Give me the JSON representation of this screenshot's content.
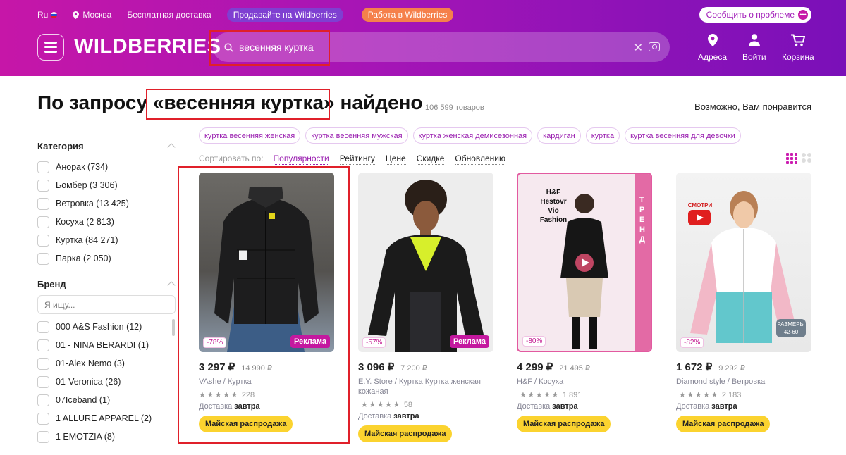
{
  "topbar": {
    "lang": "Ru",
    "city": "Москва",
    "delivery": "Бесплатная доставка",
    "sell": "Продавайте на Wildberries",
    "work": "Работа в Wildberries",
    "report": "Сообщить о проблеме"
  },
  "header": {
    "logo": "WILDBERRIES",
    "search_value": "весенняя куртка",
    "addresses": "Адреса",
    "login": "Войти",
    "cart": "Корзина"
  },
  "results": {
    "title_prefix": "По запросу ",
    "query": "«весенняя куртка»",
    "title_suffix": " найдено",
    "count": "106 599 товаров",
    "maybe": "Возможно, Вам понравится"
  },
  "tags": [
    "куртка весенняя женская",
    "куртка весенняя мужская",
    "куртка женская демисезонная",
    "кардиган",
    "куртка",
    "куртка весенняя для девочки"
  ],
  "sort": {
    "label": "Сортировать по:",
    "options": [
      "Популярности",
      "Рейтингу",
      "Цене",
      "Скидке",
      "Обновлению"
    ]
  },
  "filters": {
    "category_title": "Категория",
    "categories": [
      "Анорак (734)",
      "Бомбер (3 306)",
      "Ветровка (13 425)",
      "Косуха (2 813)",
      "Куртка (84 271)",
      "Парка (2 050)"
    ],
    "brand_title": "Бренд",
    "brand_placeholder": "Я ищу...",
    "brands": [
      "000 A&S Fashion (12)",
      "01 - NINA BERARDI (1)",
      "01-Alex Nemo (3)",
      "01-Veronica (26)",
      "07Iceband (1)",
      "1 ALLURE APPAREL (2)",
      "1 EMOTZIA (8)"
    ]
  },
  "products": [
    {
      "discount": "-78%",
      "ad": "Реклама",
      "price": "3 297 ₽",
      "old": "14 990 ₽",
      "name": "VAshe / Куртка",
      "reviews": "228",
      "delivery_label": "Доставка ",
      "delivery_day": "завтра",
      "sale": "Майская распродажа"
    },
    {
      "discount": "-57%",
      "ad": "Реклама",
      "price": "3 096 ₽",
      "old": "7 200 ₽",
      "name": "E.Y. Store / Куртка Куртка женская кожаная",
      "reviews": "58",
      "delivery_label": "Доставка ",
      "delivery_day": "завтра",
      "sale": "Майская распродажа"
    },
    {
      "discount": "-80%",
      "price": "4 299 ₽",
      "old": "21 495 ₽",
      "name": "H&F / Косуха",
      "reviews": "1 891",
      "delivery_label": "Доставка ",
      "delivery_day": "завтра",
      "img_text": "H&F Hestovr Vio Fashion",
      "img_side": "ТРЕНД",
      "sale": "Майская распродажа"
    },
    {
      "discount": "-82%",
      "price": "1 672 ₽",
      "old": "9 292 ₽",
      "name": "Diamond style / Ветровка",
      "reviews": "2 183",
      "delivery_label": "Доставка ",
      "delivery_day": "завтра",
      "img_text": "СМОТРИ ОБЗОР",
      "img_size": "РАЗМЕРЫ 42-60",
      "sale": "Майская распродажа"
    }
  ],
  "stars": "★★★★★"
}
